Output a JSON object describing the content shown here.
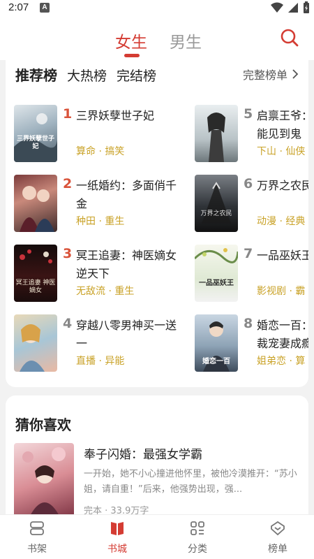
{
  "status_bar": {
    "time": "2:07",
    "notif_letter": "A"
  },
  "header": {
    "tabs": [
      {
        "label": "女生",
        "active": true
      },
      {
        "label": "男生",
        "active": false
      }
    ]
  },
  "ranking": {
    "tabs": [
      "推荐榜",
      "大热榜",
      "完结榜"
    ],
    "full_list_label": "完整榜单",
    "books": [
      {
        "rank": "1",
        "title": "三界妖孽世子妃",
        "tags": "算命 · 搞笑",
        "cover_text": "三界妖孽世子妃"
      },
      {
        "rank": "2",
        "title": "一纸婚约：多面俏千金",
        "tags": "种田 · 重生",
        "cover_text": ""
      },
      {
        "rank": "3",
        "title": "冥王追妻：神医嫡女逆天下",
        "tags": "无敌流 · 重生",
        "cover_text": "冥王追妻 神医嫡女"
      },
      {
        "rank": "4",
        "title": "穿越八零男神买一送一",
        "tags": "直播 · 异能",
        "cover_text": ""
      },
      {
        "rank": "5",
        "title": "启禀王爷：能见到鬼",
        "tags": "下山 · 仙侠",
        "cover_text": ""
      },
      {
        "rank": "6",
        "title": "万界之农民",
        "tags": "动漫 · 经典",
        "cover_text": "万界之农民"
      },
      {
        "rank": "7",
        "title": "一品巫妖王",
        "tags": "影视剧 · 霸",
        "cover_text": "一品巫妖王"
      },
      {
        "rank": "8",
        "title": "婚恋一百：裁宠妻成瘾",
        "tags": "姐弟恋 · 算",
        "cover_text": "婚恋一百"
      }
    ]
  },
  "guess": {
    "title": "猜你喜欢",
    "book": {
      "title": "奉子闪婚：最强女学霸",
      "desc": "一开始，她不小心撞进他怀里，被他冷漠推开：“苏小姐，请自重！”后来，他强势出现，强...",
      "meta": "完本 · 33.9万字"
    }
  },
  "bottom_nav": [
    {
      "label": "书架",
      "icon": "bookshelf-icon",
      "active": false
    },
    {
      "label": "书城",
      "icon": "bookstore-icon",
      "active": true
    },
    {
      "label": "分类",
      "icon": "category-icon",
      "active": false
    },
    {
      "label": "榜单",
      "icon": "ranking-icon",
      "active": false
    }
  ],
  "colors": {
    "accent": "#d43c33",
    "tag": "#c9a227",
    "rank_top": "#d9533a",
    "rank_other": "#888888"
  }
}
